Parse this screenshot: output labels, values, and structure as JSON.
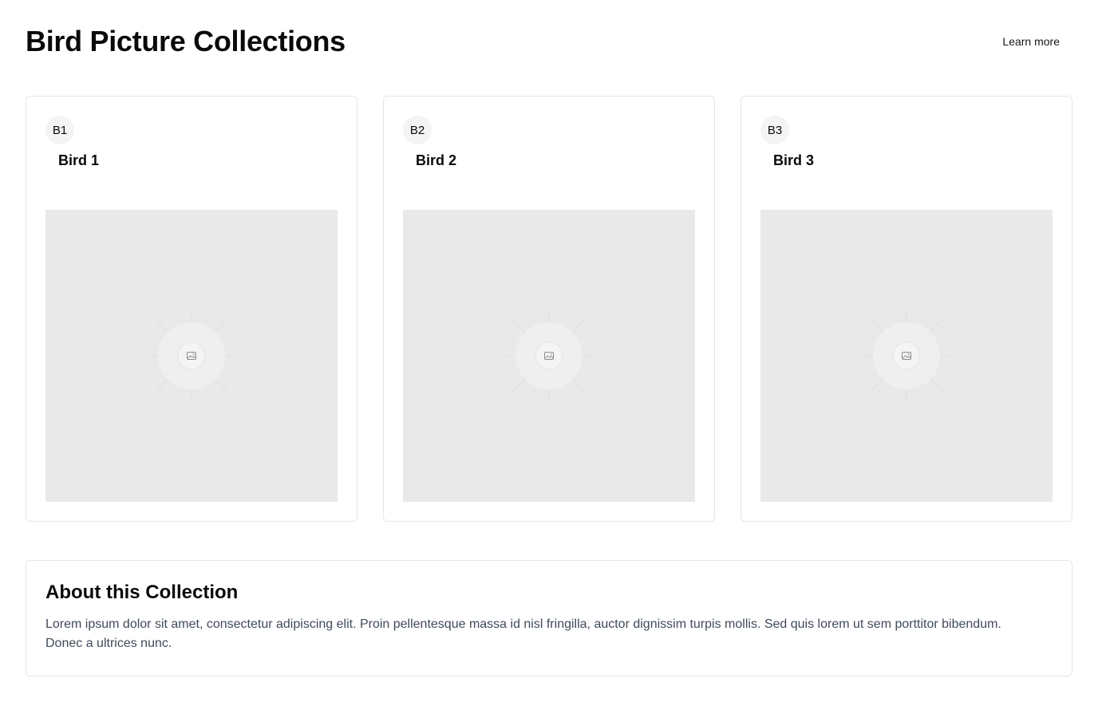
{
  "header": {
    "title": "Bird Picture Collections",
    "learn_more_label": "Learn more"
  },
  "cards": [
    {
      "badge": "B1",
      "title": "Bird 1",
      "image_icon": "image-placeholder-icon"
    },
    {
      "badge": "B2",
      "title": "Bird 2",
      "image_icon": "image-placeholder-icon"
    },
    {
      "badge": "B3",
      "title": "Bird 3",
      "image_icon": "image-placeholder-icon"
    }
  ],
  "about": {
    "title": "About this Collection",
    "text": "Lorem ipsum dolor sit amet, consectetur adipiscing elit. Proin pellentesque massa id nisl fringilla, auctor dignissim turpis mollis. Sed quis lorem ut sem porttitor bibendum. Donec a ultrices nunc."
  },
  "colors": {
    "placeholder_bg": "#e9e9e9",
    "border": "#e5e5e5",
    "badge_bg": "#f4f4f5",
    "body_text": "#404a59"
  }
}
